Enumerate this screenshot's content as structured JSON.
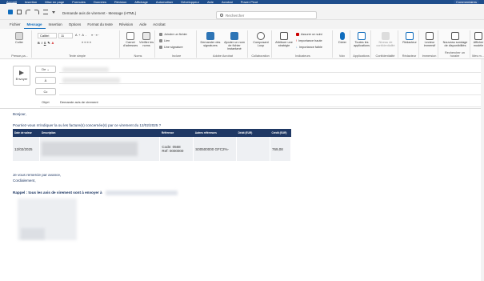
{
  "top_menu": [
    "Accueil",
    "Insertion",
    "Mise en page",
    "Formules",
    "Données",
    "Révision",
    "Affichage",
    "Automatiser",
    "Développeur",
    "Aide",
    "Acrobat",
    "Power Pivot"
  ],
  "top_right": "Commentaires",
  "window": {
    "title": "Demande avis de virement - Message (HTML)",
    "search_placeholder": "Rechercher"
  },
  "tabs": [
    "Fichier",
    "Message",
    "Insertion",
    "Options",
    "Format du texte",
    "Révision",
    "Aide",
    "Acrobat"
  ],
  "active_tab_index": 1,
  "ribbon": {
    "clipboard": {
      "paste": "Coller",
      "group": "Presse-pa..."
    },
    "font": {
      "name": "Calibri",
      "size": "11",
      "group": "Texte simple"
    },
    "names": {
      "address_book": "Carnet d'adresses",
      "check_names": "Vérifier les noms",
      "group": "Noms"
    },
    "include": {
      "attach": "Joindre un fichier",
      "link": "Lien",
      "signature": "Une signature",
      "group": "Inclure"
    },
    "signatures": {
      "btn1": "Demander des signatures",
      "btn2": "Ajouter un nom de fichier instantané",
      "group": "Adobe Acrobat"
    },
    "collab": {
      "btn": "Composant Loop",
      "group": "Collaboration"
    },
    "tags": {
      "assign": "Attribuer une stratégie",
      "tracking": "Assurer un suivi",
      "high": "Importance haute",
      "low": "Importance faible",
      "group": "Indicateurs"
    },
    "voice": {
      "btn": "Dicter",
      "group": "Voix"
    },
    "apps": {
      "btn": "Toutes les applications",
      "group": "Applications"
    },
    "sensitivity": {
      "btn": "Niveau de confidentialité",
      "group": "Confidentialité"
    },
    "editor": {
      "btn": "Rédacteur",
      "group": "Rédacteur"
    },
    "reader": {
      "btn": "Lecteur immersif",
      "group": "Immersion"
    },
    "schedule": {
      "btn": "Nouveau sondage de disponibilités",
      "group": "Rechercher un horaire"
    },
    "extra": {
      "btn": "Afficher modèle",
      "group": "Mes m..."
    }
  },
  "compose": {
    "send": "Envoyer",
    "from": "De",
    "to": "À",
    "cc": "Cc",
    "subject_label": "Objet",
    "subject": "Demande avis de virement"
  },
  "body": {
    "greeting": "Bonjour,",
    "question": "Pourriez-vous m'indiquer la ou les facture(s) concernée(s) par ce virement du 12/02/2025 ?",
    "table": {
      "headers": [
        "Date de valeur",
        "Description",
        "Référence",
        "Autres références",
        "Débit (EUR)",
        "Crédit (EUR)"
      ],
      "row": {
        "date": "12/02/2025",
        "code": "Code: 0568",
        "ref": "Ref: 0000000",
        "other": "S00500000 GFC2%-",
        "debit": "",
        "credit": "769,08"
      }
    },
    "thanks": "Je vous remercie par avance,",
    "closing": "Cordialement,",
    "rappel": "Rappel : tous les avis de virement sont à envoyer à"
  },
  "colors": {
    "brand": "#0f6cbd",
    "table_header": "#1f3864",
    "body_text": "#1f3864"
  }
}
